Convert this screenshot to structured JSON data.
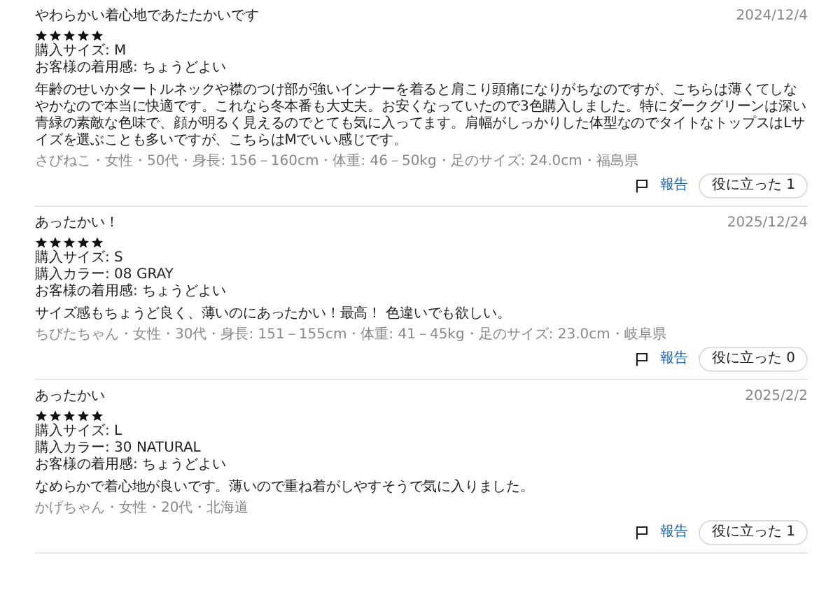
{
  "reviews": [
    {
      "title": "やわらかい着心地であたたかいです",
      "date": "2024/12/4",
      "stars": 5,
      "details": [
        "購入サイズ: M",
        "お客様の着用感: ちょうどよい"
      ],
      "body": "年齢のせいかタートルネックや襟のつけ部が強いインナーを着ると肩こり頭痛になりがちなのですが、こちらは薄くてしなやかなので本当に快適です。これなら冬本番も大丈夫。お安くなっていたので3色購入しました。特にダークグリーンは深い青緑の素敵な色味で、顔が明るく見えるのでとても気に入ってます。肩幅がしっかりした体型なのでタイトなトップスはLサイズを選ぶことも多いですが、こちらはMでいい感じです。",
      "reviewer": "さびねこ・女性・50代・身長: 156－160cm・体重: 46－50kg・足のサイズ: 24.0cm・福島県",
      "report": "報告",
      "helpful": "役に立った 1"
    },
    {
      "title": "あったかい！",
      "date": "2025/12/24",
      "stars": 5,
      "details": [
        "購入サイズ: S",
        "購入カラー: 08 GRAY",
        "お客様の着用感: ちょうどよい"
      ],
      "body": "サイズ感もちょうど良く、薄いのにあったかい！最高！ 色違いでも欲しい。",
      "reviewer": "ちびたちゃん・女性・30代・身長: 151－155cm・体重: 41－45kg・足のサイズ: 23.0cm・岐阜県",
      "report": "報告",
      "helpful": "役に立った 0"
    },
    {
      "title": "あったかい",
      "date": "2025/2/2",
      "stars": 5,
      "details": [
        "購入サイズ: L",
        "購入カラー: 30 NATURAL",
        "お客様の着用感: ちょうどよい"
      ],
      "body": "なめらかで着心地が良いです。薄いので重ね着がしやすそうで気に入りました。",
      "reviewer": "かげちゃん・女性・20代・北海道",
      "report": "報告",
      "helpful": "役に立った 1"
    }
  ]
}
